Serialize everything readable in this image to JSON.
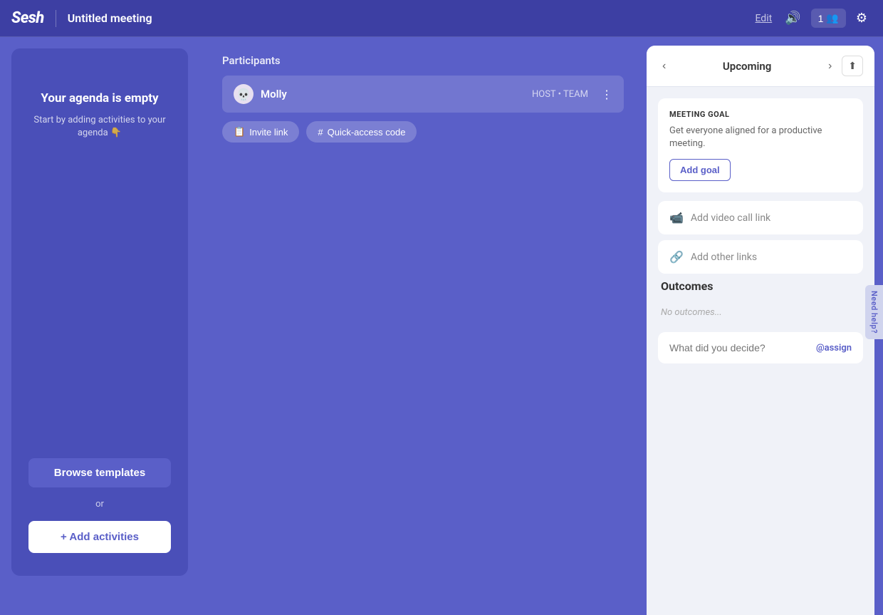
{
  "app": {
    "logo": "Sesh",
    "title": "Untitled meeting",
    "edit_label": "Edit"
  },
  "header": {
    "sound_icon": "🔊",
    "participants_count": "1",
    "settings_icon": "⚙"
  },
  "left_panel": {
    "agenda_empty_title": "Your agenda is empty",
    "agenda_empty_subtitle": "Start by adding activities to your agenda 👇",
    "browse_templates_label": "Browse templates",
    "or_label": "or",
    "add_activities_label": "+ Add activities"
  },
  "center_panel": {
    "participants_label": "Participants",
    "participant": {
      "name": "Molly",
      "role": "HOST • TEAM",
      "avatar": "💀"
    },
    "invite_link_label": "Invite link",
    "quick_access_label": "Quick-access code"
  },
  "right_panel": {
    "nav_prev": "‹",
    "nav_next": "›",
    "upcoming_label": "Upcoming",
    "share_icon": "⬆",
    "meeting_goal_title": "MEETING GOAL",
    "meeting_goal_desc": "Get everyone aligned for a productive meeting.",
    "add_goal_label": "Add goal",
    "add_video_call_label": "Add video call link",
    "add_other_links_label": "Add other links",
    "outcomes_title": "Outcomes",
    "no_outcomes_label": "No outcomes...",
    "outcome_placeholder": "What did you decide?",
    "assign_label": "@assign"
  },
  "need_help": {
    "label": "Need help?"
  }
}
